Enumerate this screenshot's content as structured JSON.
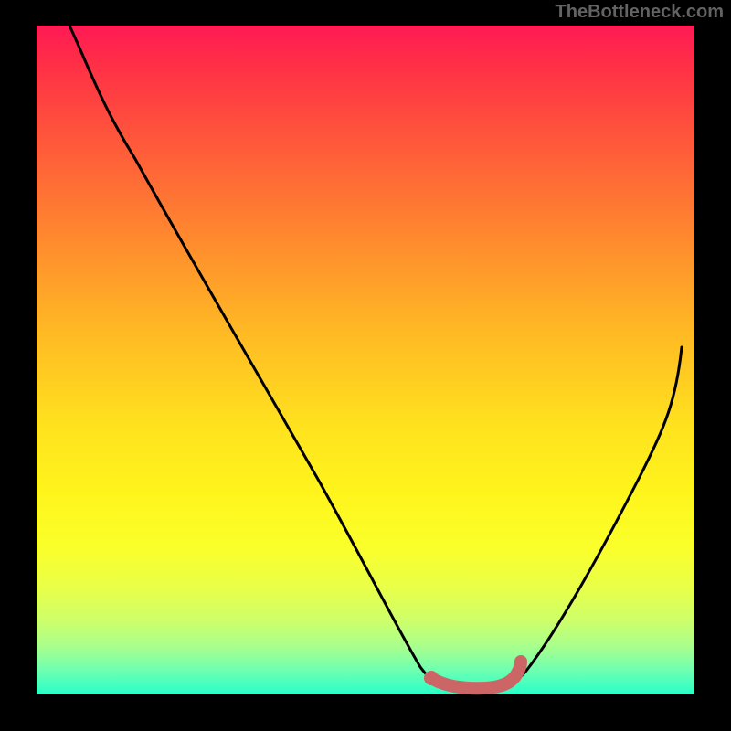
{
  "attribution": "TheBottleneck.com",
  "chart_data": {
    "type": "line",
    "title": "",
    "xlabel": "",
    "ylabel": "",
    "xlim": [
      0,
      100
    ],
    "ylim": [
      0,
      100
    ],
    "grid": false,
    "series": [
      {
        "name": "bottleneck-curve",
        "color": "#000000",
        "points": [
          {
            "x": 5,
            "y": 100
          },
          {
            "x": 8,
            "y": 93
          },
          {
            "x": 15,
            "y": 80
          },
          {
            "x": 25,
            "y": 62
          },
          {
            "x": 35,
            "y": 44
          },
          {
            "x": 45,
            "y": 27
          },
          {
            "x": 53,
            "y": 12
          },
          {
            "x": 58,
            "y": 4
          },
          {
            "x": 60,
            "y": 2
          },
          {
            "x": 63,
            "y": 1
          },
          {
            "x": 70,
            "y": 1
          },
          {
            "x": 73,
            "y": 2
          },
          {
            "x": 78,
            "y": 8
          },
          {
            "x": 85,
            "y": 22
          },
          {
            "x": 92,
            "y": 38
          },
          {
            "x": 98,
            "y": 52
          }
        ]
      },
      {
        "name": "optimal-marker",
        "color": "#cc6666",
        "points": [
          {
            "x": 60,
            "y": 2.5
          },
          {
            "x": 63,
            "y": 1.2
          },
          {
            "x": 67,
            "y": 1.0
          },
          {
            "x": 70,
            "y": 1.2
          },
          {
            "x": 72,
            "y": 2.2
          },
          {
            "x": 73.5,
            "y": 4.5
          }
        ]
      }
    ],
    "marker_dot": {
      "x": 60,
      "y": 2.5,
      "color": "#cc6666"
    },
    "gradient_stops": [
      {
        "pos": 0,
        "color": "#ff1a55"
      },
      {
        "pos": 50,
        "color": "#ffd61e"
      },
      {
        "pos": 100,
        "color": "#28ffc8"
      }
    ]
  }
}
